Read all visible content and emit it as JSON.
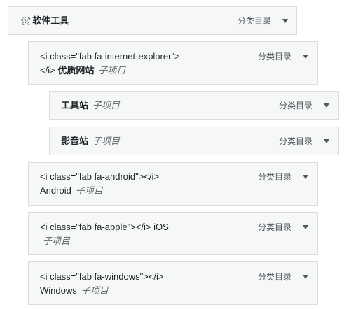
{
  "menu_items": [
    {
      "icon": "tools-icon",
      "icon_glyph": "🛠",
      "title": "软件工具",
      "type": "分类目录"
    },
    {
      "title_line1": "<i class=\"fab fa-internet-explorer\">",
      "title_code_end": "</i>",
      "title_bold": "优质网站",
      "sub": "子项目",
      "type": "分类目录"
    },
    {
      "title": "工具站",
      "sub": "子项目",
      "type": "分类目录"
    },
    {
      "title": "影音站",
      "sub": "子项目",
      "type": "分类目录"
    },
    {
      "title_line1": "<i class=\"fab fa-android\"></i>",
      "title_line2": "Android",
      "sub": "子项目",
      "type": "分类目录"
    },
    {
      "title_line1": "<i class=\"fab fa-apple\"></i> iOS",
      "sub": "子项目",
      "type": "分类目录"
    },
    {
      "title_line1": "<i class=\"fab fa-windows\"></i>",
      "title_line2": "Windows",
      "sub": "子项目",
      "type": "分类目录"
    }
  ]
}
